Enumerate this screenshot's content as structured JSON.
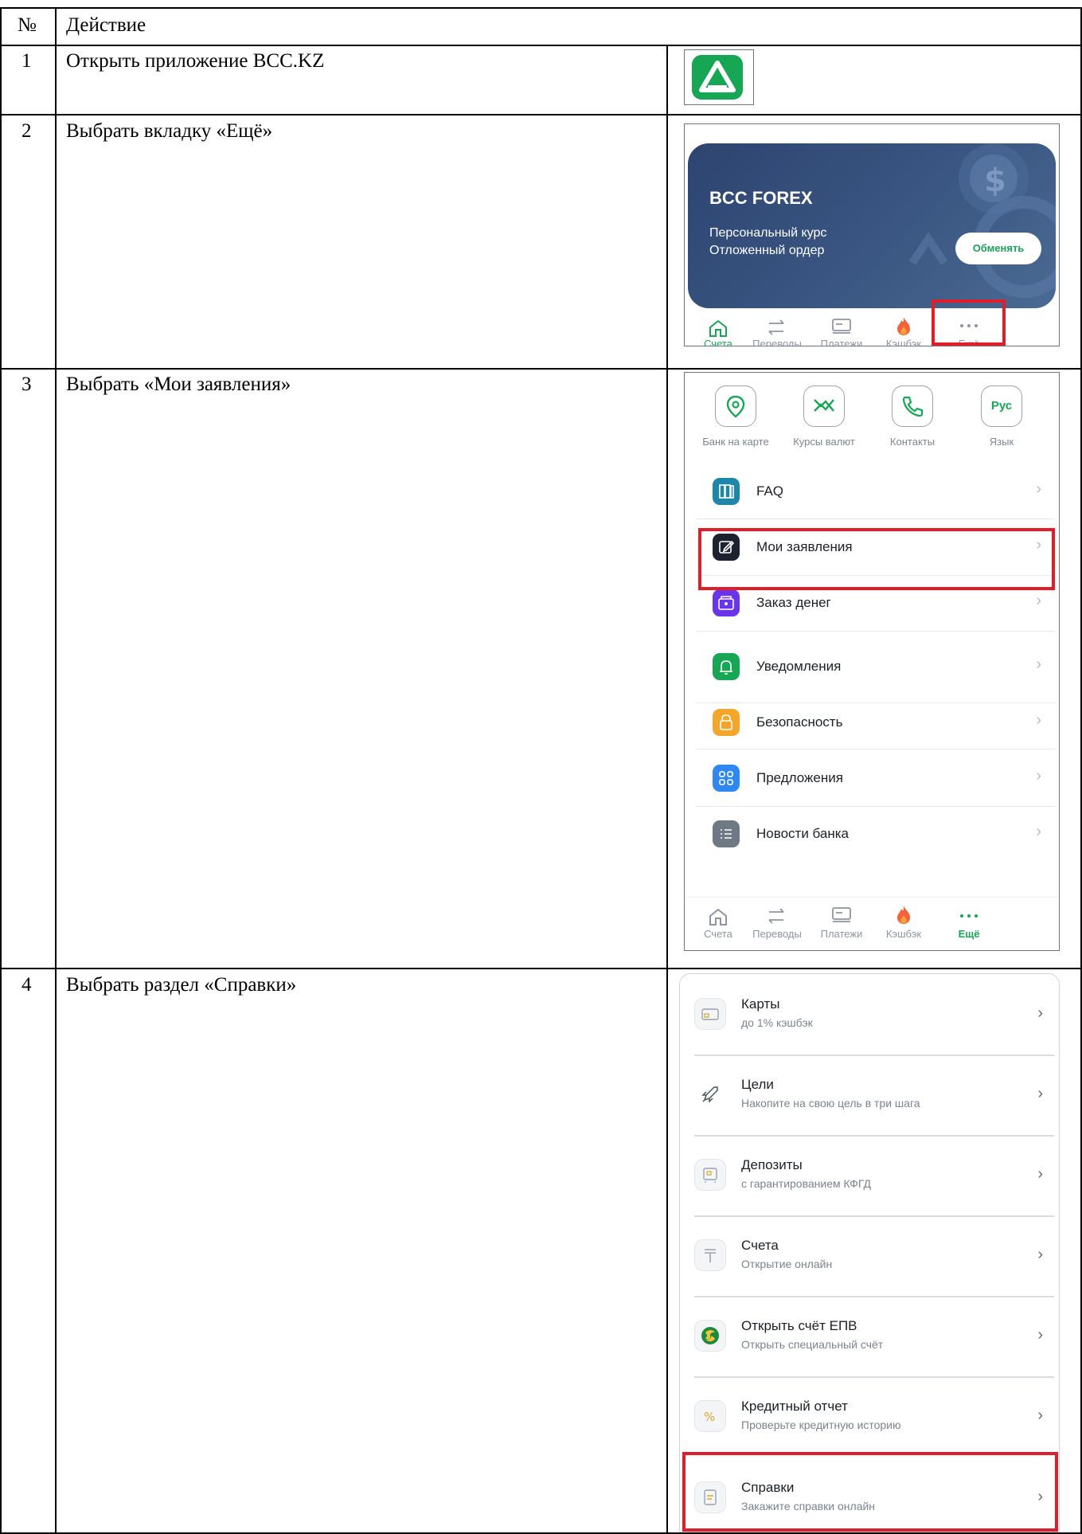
{
  "table": {
    "header": {
      "num": "№",
      "action": "Действие"
    },
    "rows": [
      {
        "num": "1",
        "action": "Открыть приложение BCC.KZ"
      },
      {
        "num": "2",
        "action": "Выбрать вкладку «Ещё»"
      },
      {
        "num": "3",
        "action": "Выбрать «Мои заявления»"
      },
      {
        "num": "4",
        "action": "Выбрать раздел «Справки»"
      }
    ]
  },
  "step1": {
    "icon": "bcc-app-icon",
    "icon_color": "#17a754"
  },
  "step2": {
    "banner": {
      "title": "BCC FOREX",
      "line1": "Персональный курс",
      "line2": "Отложенный ордер",
      "button": "Обменять"
    },
    "tabs": [
      {
        "label": "Счета",
        "icon": "home-icon",
        "active": true
      },
      {
        "label": "Переводы",
        "icon": "transfer-icon",
        "active": false
      },
      {
        "label": "Платежи",
        "icon": "payments-icon",
        "active": false
      },
      {
        "label": "Кэшбэк",
        "icon": "fire-icon",
        "active": false
      },
      {
        "label": "Ещё",
        "icon": "more-dots-icon",
        "active": false,
        "highlighted": true
      }
    ]
  },
  "step3": {
    "quick": [
      {
        "label": "Банк на карте",
        "icon": "location-pin-icon"
      },
      {
        "label": "Курсы валют",
        "icon": "exchange-rates-icon"
      },
      {
        "label": "Контакты",
        "icon": "phone-icon"
      },
      {
        "label": "Язык",
        "icon": "language-icon",
        "badge": "Рус"
      }
    ],
    "menu": [
      {
        "label": "FAQ",
        "icon": "faq-icon",
        "color": "#1e86a8"
      },
      {
        "label": "Мои заявления",
        "icon": "edit-icon",
        "color": "#1d2230",
        "highlighted": true
      },
      {
        "label": "Заказ денег",
        "icon": "wallet-icon",
        "color": "#6a35e8"
      },
      {
        "label": "Уведомления",
        "icon": "bell-icon",
        "color": "#17a754"
      },
      {
        "label": "Безопасность",
        "icon": "lock-icon",
        "color": "#f4a62a"
      },
      {
        "label": "Предложения",
        "icon": "grid-icon",
        "color": "#2f88f0"
      },
      {
        "label": "Новости банка",
        "icon": "list-icon",
        "color": "#6f7885"
      }
    ],
    "tabs": [
      {
        "label": "Счета",
        "icon": "home-icon",
        "active": false
      },
      {
        "label": "Переводы",
        "icon": "transfer-icon",
        "active": false
      },
      {
        "label": "Платежи",
        "icon": "payments-icon",
        "active": false
      },
      {
        "label": "Кэшбэк",
        "icon": "fire-icon",
        "active": false
      },
      {
        "label": "Ещё",
        "icon": "more-dots-icon",
        "active": true
      }
    ]
  },
  "step4": {
    "services": [
      {
        "title": "Карты",
        "subtitle": "до 1% кэшбэк",
        "icon": "card-icon"
      },
      {
        "title": "Цели",
        "subtitle": "Накопите на свою цель в три шага",
        "icon": "rocket-icon"
      },
      {
        "title": "Депозиты",
        "subtitle": "с гарантированием КФГД",
        "icon": "safe-icon"
      },
      {
        "title": "Счета",
        "subtitle": "Открытие онлайн",
        "icon": "tenge-icon"
      },
      {
        "title": "Открыть счёт ЕПВ",
        "subtitle": "Открыть специальный счёт",
        "icon": "epv-icon"
      },
      {
        "title": "Кредитный отчет",
        "subtitle": "Проверьте кредитную историю",
        "icon": "percent-icon"
      },
      {
        "title": "Справки",
        "subtitle": "Закажите справки онлайн",
        "icon": "document-icon",
        "highlighted": true
      }
    ]
  },
  "colors": {
    "accent_green": "#17a754",
    "highlight_red": "#e21d2a",
    "forex_blue": "#344c78"
  }
}
